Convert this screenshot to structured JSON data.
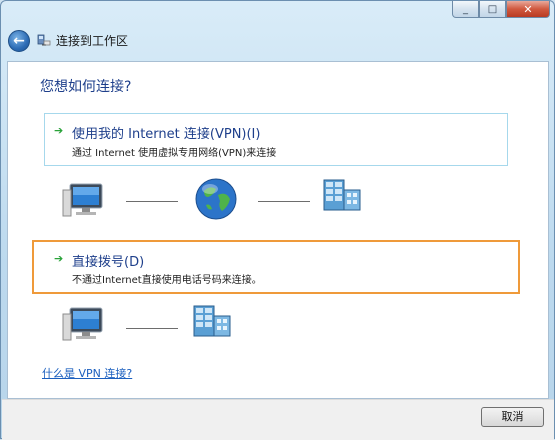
{
  "window": {
    "title": "连接到工作区",
    "controls": {
      "minimize": "_",
      "maximize": "□",
      "close": "✕"
    }
  },
  "main": {
    "heading": "您想如何连接?",
    "options": [
      {
        "title": "使用我的 Internet 连接(VPN)(I)",
        "description": "通过 Internet 使用虚拟专用网络(VPN)来连接",
        "icons": [
          "computer-icon",
          "globe-icon",
          "server-icon"
        ]
      },
      {
        "title": "直接拨号(D)",
        "description": "不通过Internet直接使用电话号码来连接。",
        "icons": [
          "computer-icon",
          "server-icon"
        ]
      }
    ],
    "help_link": "什么是 VPN 连接?"
  },
  "footer": {
    "cancel_label": "取消"
  },
  "colors": {
    "heading": "#1e3f8b",
    "highlight_border": "#ef9a3a",
    "link": "#1b5fbf",
    "arrow": "#2aa33a"
  }
}
